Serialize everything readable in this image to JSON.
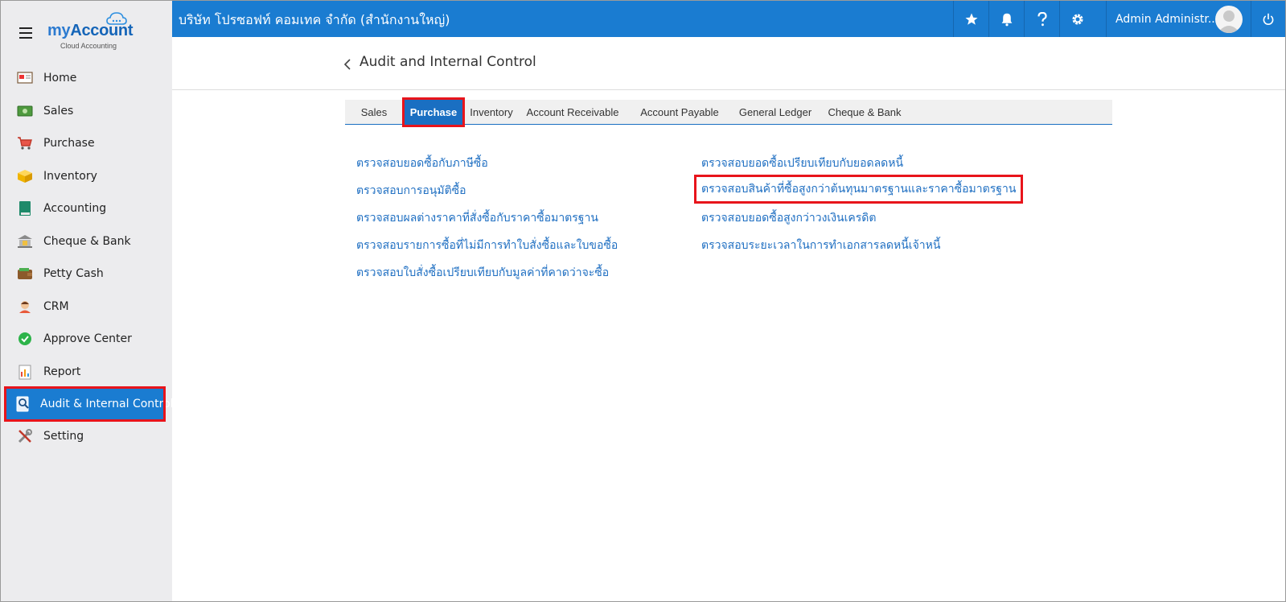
{
  "app": {
    "logo_my": "my",
    "logo_account": "Account",
    "logo_sub": "Cloud Accounting"
  },
  "sidebar": {
    "items": [
      {
        "label": "Home",
        "icon": "home-icon"
      },
      {
        "label": "Sales",
        "icon": "money-icon"
      },
      {
        "label": "Purchase",
        "icon": "cart-icon"
      },
      {
        "label": "Inventory",
        "icon": "box-icon"
      },
      {
        "label": "Accounting",
        "icon": "ledger-book-icon"
      },
      {
        "label": "Cheque & Bank",
        "icon": "bank-icon"
      },
      {
        "label": "Petty Cash",
        "icon": "wallet-icon"
      },
      {
        "label": "CRM",
        "icon": "customer-icon"
      },
      {
        "label": "Approve Center",
        "icon": "check-circle-icon"
      },
      {
        "label": "Report",
        "icon": "report-icon"
      },
      {
        "label": "Audit & Internal Control",
        "icon": "audit-icon",
        "active": true
      },
      {
        "label": "Setting",
        "icon": "tools-icon"
      }
    ]
  },
  "header": {
    "company": "บริษัท โปรซอฟท์ คอมเทค จำกัด (สำนักงานใหญ่)",
    "user": "Admin Administr...",
    "icons": [
      "star-icon",
      "bell-icon",
      "help-icon",
      "settings-gear-icon",
      "power-icon"
    ]
  },
  "page": {
    "title": "Audit and Internal Control"
  },
  "tabs": [
    {
      "label": "Sales"
    },
    {
      "label": "Purchase",
      "active": true
    },
    {
      "label": "Inventory"
    },
    {
      "label": "Account Receivable"
    },
    {
      "label": "Account Payable"
    },
    {
      "label": "General Ledger"
    },
    {
      "label": "Cheque & Bank"
    }
  ],
  "links": {
    "left": [
      "ตรวจสอบยอดซื้อกับภาษีซื้อ",
      "ตรวจสอบการอนุมัติซื้อ",
      "ตรวจสอบผลต่างราคาที่สั่งซื้อกับราคาซื้อมาตรฐาน",
      "ตรวจสอบรายการซื้อที่ไม่มีการทำใบสั่งซื้อและใบขอซื้อ",
      "ตรวจสอบใบสั่งซื้อเปรียบเทียบกับมูลค่าที่คาดว่าจะซื้อ"
    ],
    "right": [
      "ตรวจสอบยอดซื้อเปรียบเทียบกับยอดลดหนี้",
      "ตรวจสอบสินค้าที่ซื้อสูงกว่าต้นทุนมาตรฐานและราคาซื้อมาตรฐาน",
      "ตรวจสอบยอดซื้อสูงกว่าวงเงินเครดิต",
      "ตรวจสอบระยะเวลาในการทำเอกสารลดหนี้เจ้าหนี้"
    ]
  },
  "colors": {
    "primary": "#1a7cd1",
    "highlight": "#e8141b",
    "link": "#1f6fc2"
  }
}
